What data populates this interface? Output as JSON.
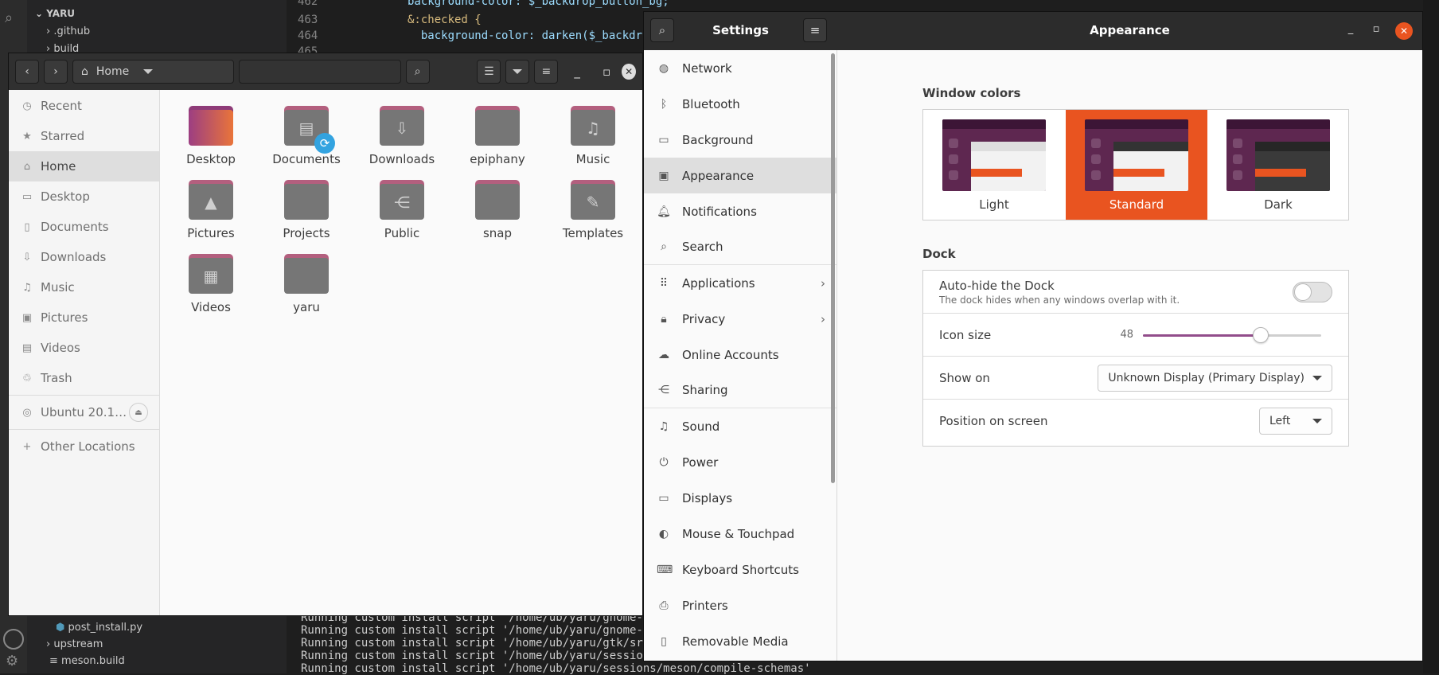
{
  "vscode": {
    "explorer_root": "YARU",
    "tree_top": [
      ".github",
      "build"
    ],
    "tree_bottom": [
      "post_install.py",
      "upstream",
      "meson.build"
    ],
    "line_numbers": [
      "462",
      "463",
      "464",
      "465"
    ],
    "code_lines": [
      "background-color: $_backdrop_button_bg;",
      "&:checked {",
      "  background-color: darken($_backdr",
      ""
    ],
    "terminal_lines": [
      "Running custom install script '/home/ub/yaru/gnome-she",
      "Running custom install script '/home/ub/yaru/gnome-she",
      "Running custom install script '/home/ub/yaru/gtk/src/p",
      "Running custom install script '/home/ub/yaru/sessions/",
      "Running custom install script '/home/ub/yaru/sessions/meson/compile-schemas'"
    ]
  },
  "nautilus": {
    "location": "Home",
    "sidebar": [
      "Recent",
      "Starred",
      "Home",
      "Desktop",
      "Documents",
      "Downloads",
      "Music",
      "Pictures",
      "Videos",
      "Trash",
      "Ubuntu 20.1…",
      "Other Locations"
    ],
    "folders": [
      "Desktop",
      "Documents",
      "Downloads",
      "epiphany",
      "Music",
      "Pictures",
      "Projects",
      "Public",
      "snap",
      "Templates",
      "Videos",
      "yaru"
    ]
  },
  "settings": {
    "title": "Settings",
    "panel_title": "Appearance",
    "nav": [
      "Network",
      "Bluetooth",
      "Background",
      "Appearance",
      "Notifications",
      "Search",
      "Applications",
      "Privacy",
      "Online Accounts",
      "Sharing",
      "Sound",
      "Power",
      "Displays",
      "Mouse & Touchpad",
      "Keyboard Shortcuts",
      "Printers",
      "Removable Media"
    ],
    "window_colors_title": "Window colors",
    "themes": [
      "Light",
      "Standard",
      "Dark"
    ],
    "selected_theme": "Standard",
    "dock_title": "Dock",
    "autohide_label": "Auto-hide the Dock",
    "autohide_desc": "The dock hides when any windows overlap with it.",
    "autohide_on": false,
    "icon_size_label": "Icon size",
    "icon_size_value": "48",
    "icon_size_fraction": 0.66,
    "show_on_label": "Show on",
    "show_on_value": "Unknown Display (Primary Display)",
    "position_label": "Position on screen",
    "position_value": "Left"
  },
  "colors": {
    "accent": "#e95420",
    "aubergine": "#5e2750"
  }
}
